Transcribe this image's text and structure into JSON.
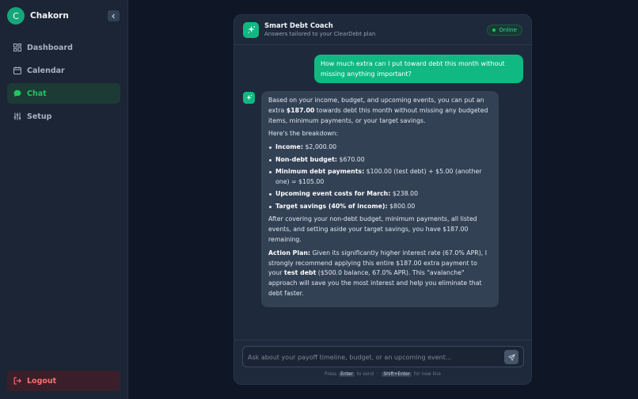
{
  "sidebar": {
    "avatar_initial": "C",
    "brand_name": "Chakorn",
    "collapse_icon": "chevron-left-icon",
    "items": [
      {
        "label": "Dashboard",
        "icon": "grid-icon"
      },
      {
        "label": "Calendar",
        "icon": "calendar-icon"
      },
      {
        "label": "Chat",
        "icon": "chat-bubble-icon",
        "active": true
      },
      {
        "label": "Setup",
        "icon": "sliders-icon"
      }
    ],
    "logout_label": "Logout"
  },
  "chat": {
    "title": "Smart Debt Coach",
    "subtitle": "Answers tailored to your ClearDebt plan",
    "status": "Online",
    "user_message": "How much extra can I put toward debt this month without missing anything important?",
    "bot": {
      "intro_a": "Based on your income, budget, and upcoming events, you can put an extra ",
      "intro_amount": "$187.00",
      "intro_b": " towards debt this month without missing any budgeted items, minimum payments, or your target savings.",
      "breakdown_heading": "Here's the breakdown:",
      "breakdown": [
        {
          "label": "Income:",
          "value": " $2,000.00"
        },
        {
          "label": "Non-debt budget:",
          "value": " $670.00"
        },
        {
          "label": "Minimum debt payments:",
          "value": " $100.00 (test debt) + $5.00 (another one) = $105.00"
        },
        {
          "label": "Upcoming event costs for March:",
          "value": " $238.00"
        },
        {
          "label": "Target savings (40% of income):",
          "value": " $800.00"
        }
      ],
      "summary": "After covering your non-debt budget, minimum payments, all listed events, and setting aside your target savings, you have $187.00 remaining.",
      "plan_label": "Action Plan:",
      "plan_a": " Given its significantly higher interest rate (67.0% APR), I strongly recommend applying this entire $187.00 extra payment to your ",
      "plan_bold": "test debt",
      "plan_b": " ($500.0 balance, 67.0% APR). This \"avalanche\" approach will save you the most interest and help you eliminate that debt faster."
    },
    "input": {
      "placeholder": "Ask about your payoff timeline, budget, or an upcoming event...",
      "value": ""
    },
    "hint": {
      "press": "Press",
      "key_enter": "Enter",
      "to_send": "to send",
      "key_shift_enter": "Shift+Enter",
      "new_line": "for new line"
    }
  },
  "colors": {
    "accent": "#10b981",
    "background": "#0f1726",
    "panel": "#1e293b",
    "logout": "#f87171"
  }
}
